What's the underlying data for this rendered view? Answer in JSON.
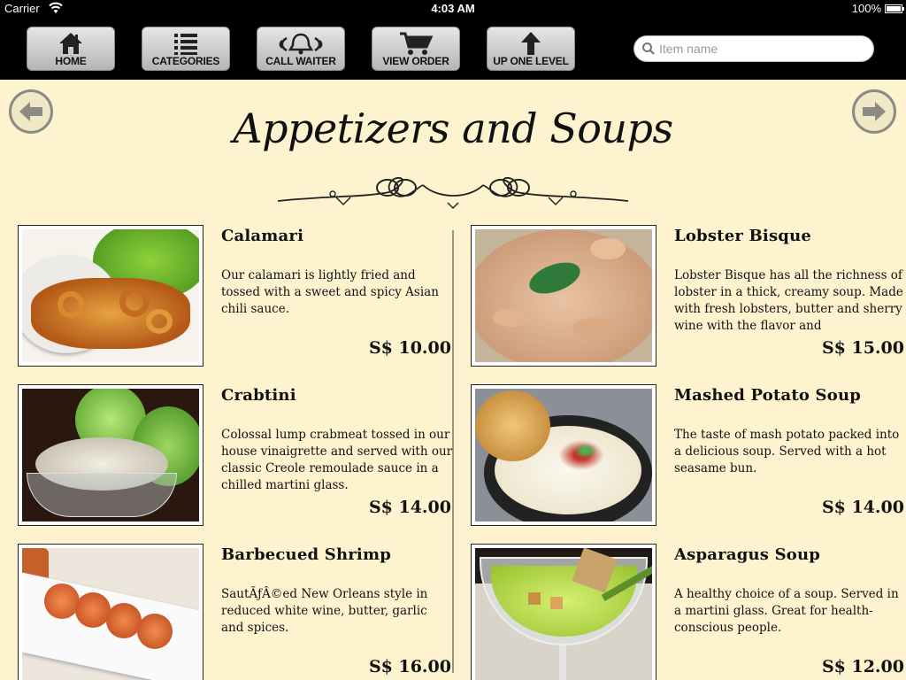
{
  "status_bar": {
    "carrier": "Carrier",
    "time": "4:03 AM",
    "battery": "100%"
  },
  "toolbar": {
    "buttons": [
      {
        "label": "HOME",
        "icon": "house-icon"
      },
      {
        "label": "CATEGORIES",
        "icon": "list-icon"
      },
      {
        "label": "CALL WAITER",
        "icon": "bell-icon"
      },
      {
        "label": "VIEW ORDER",
        "icon": "cart-icon"
      },
      {
        "label": "UP ONE LEVEL",
        "icon": "up-arrow-icon"
      }
    ],
    "search": {
      "placeholder": "Item name",
      "value": ""
    }
  },
  "page": {
    "title": "Appetizers and Soups",
    "prev_icon": "arrow-left-icon",
    "next_icon": "arrow-right-icon"
  },
  "items": [
    {
      "name": "Calamari",
      "description": "Our calamari is lightly fried and tossed with a sweet and spicy Asian chili sauce.",
      "price": "S$ 10.00"
    },
    {
      "name": "Lobster Bisque",
      "description": "Lobster Bisque has all the richness of lobster in a thick, creamy soup. Made with fresh lobsters, butter and sherry wine with the flavor and",
      "price": "S$ 15.00"
    },
    {
      "name": "Crabtini",
      "description": "Colossal lump crabmeat tossed in our house vinaigrette and served with our classic Creole remoulade sauce in a chilled martini glass.",
      "price": "S$ 14.00"
    },
    {
      "name": "Mashed Potato Soup",
      "description": "The taste of mash potato packed into a delicious soup. Served with a hot seasame bun.",
      "price": "S$ 14.00"
    },
    {
      "name": "Barbecued Shrimp",
      "description": "SautÃƒÂ©ed New Orleans style in reduced white wine, butter, garlic and spices.",
      "price": "S$ 16.00"
    },
    {
      "name": "Asparagus Soup",
      "description": "A healthy choice of a soup.  Served in a martini glass.  Great for health-conscious people.",
      "price": "S$ 12.00"
    }
  ],
  "colors": {
    "background": "#fdf3cf",
    "toolbar": "#000000",
    "button_top": "#e6e6e6",
    "button_bottom": "#b5b5b5"
  }
}
